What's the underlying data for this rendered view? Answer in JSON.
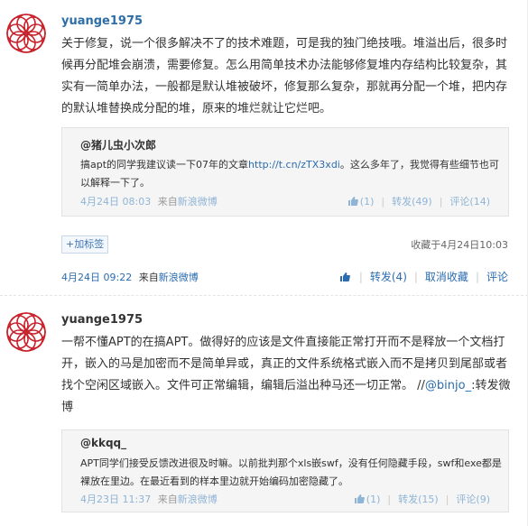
{
  "post1": {
    "author": "yuange1975",
    "text": "关于修复，说一个很多解决不了的技术难题，可是我的独门绝技哦。堆溢出后，很多时候再分配堆会崩溃，需要修复。怎么用简单技术办法能够修复堆内存结构比较复杂，其实有一简单办法，一般都是默认堆被破坏，修复那么复杂，那就再分配一个堆，把内存的默认堆替换成分配的堆，原来的堆烂就让它烂吧。",
    "quote": {
      "author": "@猪儿虫小次郎",
      "text_before": "搞apt的同学我建议读一下07年的文章",
      "link": "http://t.cn/zTX3xdi",
      "text_after": "。这么多年了，我觉得有些细节也可以解释一下了。",
      "time": "4月24日 08:03",
      "from_label": "来自",
      "source": "新浪微博",
      "likes": "(1)",
      "repost": "转发(49)",
      "comment": "评论(14)"
    },
    "tag_button": "+加标签",
    "favorited": "收藏于4月24日10:03",
    "time": "4月24日 09:22",
    "from_label": "来自",
    "source": "新浪微博",
    "like_label": "",
    "repost": "转发(4)",
    "unfavorite": "取消收藏",
    "comment": "评论"
  },
  "post2": {
    "author": "yuange1975",
    "text_before": "一帮不懂APT的在搞APT。做得好的应该是文件直接能正常打开而不是释放一个文档打开，嵌入的马是加密而不是简单异或，真正的文件系统格式嵌入而不是拷贝到尾部或者找个空闲区域嵌入。文件可正常编辑，编辑后溢出种马还一切正常。 //",
    "mention": "@binjo_",
    "text_after": ":转发微博",
    "quote": {
      "author": "@kkqq_",
      "text": "APT同学们接受反馈改进很及时嘛。以前批判那个xls嵌swf，没有任何隐藏手段，swf和exe都是裸放在里边。在最近看到的样本里边就开始编码加密隐藏了。",
      "time": "4月23日 11:37",
      "from_label": "来自",
      "source": "新浪微博",
      "likes": "(1)",
      "repost": "转发(15)",
      "comment": "评论(9)"
    }
  }
}
